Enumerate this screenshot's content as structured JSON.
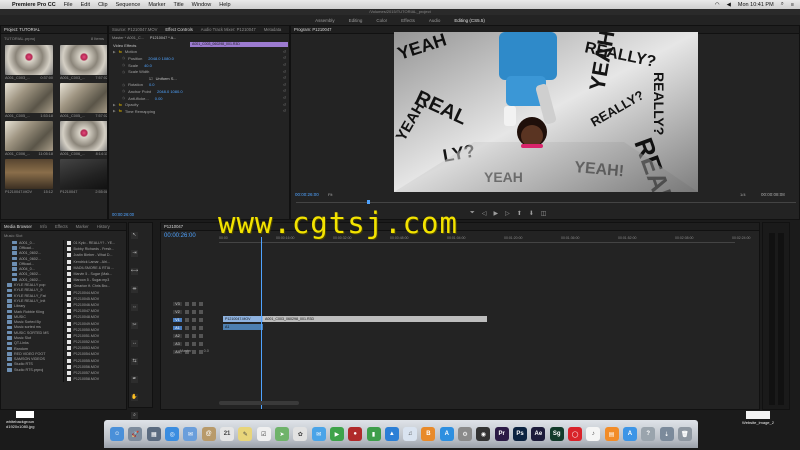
{
  "menubar": {
    "app_name": "Premiere Pro CC",
    "items": [
      "File",
      "Edit",
      "Clip",
      "Sequence",
      "Marker",
      "Title",
      "Window",
      "Help"
    ],
    "clock": "Mon 10:41 PM"
  },
  "title_bar": "/Volumes/2015/TUTORIAL_project",
  "workspace_tabs": [
    "Assembly",
    "Editing",
    "Color",
    "Effects",
    "Audio",
    "Editing (CS5.5)"
  ],
  "project_panel": {
    "tab": "Project: TUTORIAL",
    "project_file": "TUTORIAL.prproj",
    "item_count": "8 Items",
    "thumbs": [
      {
        "name": "A001_C003_...",
        "duration": "0:37:00",
        "style": "pink"
      },
      {
        "name": "A001_C003_...",
        "duration": "7:57:02",
        "style": "pink"
      },
      {
        "name": "A001_C005_...",
        "duration": "1:53:18",
        "style": "sky"
      },
      {
        "name": "A001_C005_...",
        "duration": "7:57:02",
        "style": "sky"
      },
      {
        "name": "A001_C006_...",
        "duration": "11:05:18",
        "style": "sky"
      },
      {
        "name": "A001_C006_...",
        "duration": "8:14:11",
        "style": "pink"
      },
      {
        "name": "P1210047.MOV",
        "duration": "15:12",
        "style": "indoor"
      },
      {
        "name": "P1210047",
        "duration": "2:55:08",
        "style": "dark"
      }
    ]
  },
  "effect_panel": {
    "tabs": [
      "Source: P1210047.MOV",
      "Effect Controls",
      "Audio Track Mixer: P1210047",
      "Metadata"
    ],
    "master_label": "Master * A001_C...",
    "seq_label": "P1210047 * A...",
    "section": "Video Effects",
    "clip_name": "A001_C003_060298_001.R3D",
    "rows": [
      {
        "label": "Motion",
        "value": "",
        "type": "fx"
      },
      {
        "label": "Position",
        "value": "2048.0   1080.0",
        "type": "prop"
      },
      {
        "label": "Scale",
        "value": "40.0",
        "type": "prop"
      },
      {
        "label": "Scale Width",
        "value": "",
        "type": "prop"
      },
      {
        "label": "",
        "value": "Uniform S...",
        "type": "check"
      },
      {
        "label": "Rotation",
        "value": "0.0",
        "type": "prop"
      },
      {
        "label": "Anchor Point",
        "value": "2048.0   1080.0",
        "type": "prop"
      },
      {
        "label": "Anti-flicke...",
        "value": "0.00",
        "type": "prop"
      },
      {
        "label": "Opacity",
        "value": "",
        "type": "fx"
      },
      {
        "label": "Time Remapping",
        "value": "",
        "type": "fx"
      }
    ],
    "timecode": "00:00:26:00"
  },
  "program_monitor": {
    "tab": "Program: P1210047",
    "timecode": "00:00:26:00",
    "fit": "Fit",
    "zoom": "1/4",
    "duration": "00:00:08:08",
    "wall_words": [
      "YEAH",
      "REALLY?",
      "YEAH",
      "REALLY",
      "REAL",
      "LY?",
      "YEAH!",
      "REALLY?",
      "YEAH",
      "REALLY?",
      "YEAH"
    ]
  },
  "media_browser": {
    "tabs": [
      "Media Browser",
      "Info",
      "Effects",
      "Marker",
      "History"
    ],
    "current": "Music Slot",
    "tree": [
      "A001_0...",
      "Offload...",
      "A001_0602...",
      "A001_0602...",
      "Offload...",
      "A004_0...",
      "A001_0602...",
      "A001_0602...",
      "KYLE REALLY pop",
      "KYLE REALLY_9",
      "KYLE REALLY_Fat",
      "KYLE REALLY_Init",
      "Library",
      "Mark Robbie Kling",
      "MUSIC",
      "Music Sorted By",
      "Music sorted ms",
      "MUSIC SORTED MS",
      "Music Slot",
      "QT-Links",
      "Random",
      "RED VIDEO FOOT",
      "SAMSON VIDEOS",
      "Studio RTS",
      "Studio RTS.prproj"
    ],
    "files": [
      "01 Kylo - REALLY? - YE...",
      "Bobby Richards - Fresh...",
      "Justin Bieber - What D...",
      "Kendrick Lamar - Alri...",
      "MADILSMORE & RTIA ...",
      "Marvin 5 - Sugar (Mak...",
      "Maroon 5 - Sugar.mp3",
      "Omarion ft. Chris Bro...",
      "P1210044.MOV",
      "P1210045.MOV",
      "P1210046.MOV",
      "P1210047.MOV",
      "P1210048.MOV",
      "P1210049.MOV",
      "P1210050.MOV",
      "P1210051.MOV",
      "P1210052.MOV",
      "P1210053.MOV",
      "P1210054.MOV",
      "P1210055.MOV",
      "P1210056.MOV",
      "P1210057.MOV",
      "P1210058.MOV"
    ]
  },
  "timeline": {
    "tab": "P1210047",
    "timecode": "00:00:26:00",
    "ruler": [
      "00:00",
      "00:00:16:00",
      "00:00:32:00",
      "00:00:48:00",
      "00:01:04:00",
      "00:01:20:00",
      "00:01:36:00",
      "00:01:52:00",
      "00:02:08:00",
      "00:02:24:00"
    ],
    "tracks": [
      "V3",
      "V2",
      "V1",
      "A1",
      "A2",
      "A3",
      "A4"
    ],
    "master": "Master",
    "master_value": "0.0",
    "clip_v1a": "P1210047.MOV",
    "clip_v1b": "A001_C003_060298_001.R3D",
    "clip_a1": "A1"
  },
  "desktop": {
    "left_file": "whitebackgroun d1920x1080.jpg",
    "right_file": "Website_image_2"
  },
  "dock_icons": [
    {
      "name": "finder",
      "label": "☺",
      "color": "#4a90d9"
    },
    {
      "name": "launchpad",
      "label": "🚀",
      "color": "#7d8b9c"
    },
    {
      "name": "mission-control",
      "label": "▦",
      "color": "#5b6b80"
    },
    {
      "name": "safari",
      "label": "◎",
      "color": "#3b8de0"
    },
    {
      "name": "mail",
      "label": "✉",
      "color": "#6a9edb"
    },
    {
      "name": "contacts",
      "label": "@",
      "color": "#b89a6a"
    },
    {
      "name": "calendar",
      "label": "21",
      "color": "#e5e5e5"
    },
    {
      "name": "notes",
      "label": "✎",
      "color": "#e8d57a"
    },
    {
      "name": "reminders",
      "label": "☑",
      "color": "#f0f0f0"
    },
    {
      "name": "maps",
      "label": "➤",
      "color": "#6fb36a"
    },
    {
      "name": "photos",
      "label": "✿",
      "color": "#e2e2e2"
    },
    {
      "name": "messages",
      "label": "✉",
      "color": "#4aa4e8"
    },
    {
      "name": "facetime",
      "label": "▶",
      "color": "#3ea34a"
    },
    {
      "name": "photobooth",
      "label": "●",
      "color": "#b02a2a"
    },
    {
      "name": "numbers",
      "label": "▮",
      "color": "#3e9e4b"
    },
    {
      "name": "keynote",
      "label": "▲",
      "color": "#2b7fd6"
    },
    {
      "name": "itunes",
      "label": "♫",
      "color": "#d9e3f0"
    },
    {
      "name": "ibooks",
      "label": "B",
      "color": "#e88a2a"
    },
    {
      "name": "app-store",
      "label": "A",
      "color": "#2d8fe0"
    },
    {
      "name": "system-prefs",
      "label": "⚙",
      "color": "#8a8a8a"
    },
    {
      "name": "dvd-player",
      "label": "◉",
      "color": "#333"
    },
    {
      "name": "premiere",
      "label": "Pr",
      "color": "#2b1a45"
    },
    {
      "name": "photoshop",
      "label": "Ps",
      "color": "#0c2340"
    },
    {
      "name": "after-effects",
      "label": "Ae",
      "color": "#1c1b3a"
    },
    {
      "name": "speedgrade",
      "label": "Sg",
      "color": "#123b2a"
    },
    {
      "name": "creative-cloud",
      "label": "◯",
      "color": "#d9232a"
    },
    {
      "name": "music",
      "label": "♪",
      "color": "#f5f5f5"
    },
    {
      "name": "books",
      "label": "▤",
      "color": "#f28c28"
    },
    {
      "name": "appstore2",
      "label": "A",
      "color": "#3d95e6"
    },
    {
      "name": "utility",
      "label": "?",
      "color": "#9aa4ad"
    },
    {
      "name": "downloads",
      "label": "⇣",
      "color": "#7b8a9b"
    },
    {
      "name": "trash",
      "label": "🗑",
      "color": "#8e97a1"
    }
  ]
}
